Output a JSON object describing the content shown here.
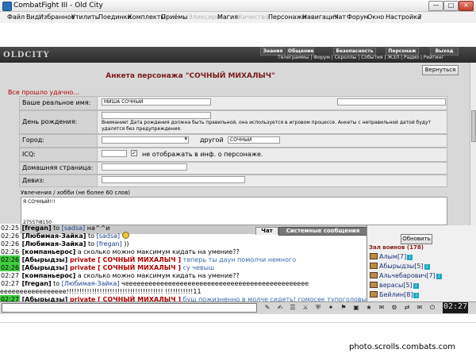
{
  "window": {
    "title": "CombatFight III - Old City"
  },
  "menu": [
    {
      "label": "Файл",
      "disabled": false
    },
    {
      "label": "Вид",
      "disabled": false
    },
    {
      "label": "Избранное",
      "disabled": false
    },
    {
      "label": "Утилиты",
      "disabled": false
    },
    {
      "label": "Поединки",
      "disabled": false
    },
    {
      "label": "Комплекты",
      "disabled": false
    },
    {
      "label": "Приёмы",
      "disabled": false
    },
    {
      "label": "Эликсиры",
      "disabled": true
    },
    {
      "label": "Магия",
      "disabled": false
    },
    {
      "label": "Качество",
      "disabled": true
    },
    {
      "label": "Персонажи",
      "disabled": false
    },
    {
      "label": "Навигация",
      "disabled": false
    },
    {
      "label": "Чат",
      "disabled": false
    },
    {
      "label": "Форум",
      "disabled": false
    },
    {
      "label": "Окно",
      "disabled": false
    },
    {
      "label": "Настройки",
      "disabled": false
    },
    {
      "label": "?",
      "disabled": false
    }
  ],
  "game": {
    "logo": "OLDCITY",
    "tabs": [
      "Знания",
      "Общение",
      "Безопасность",
      "Персонаж",
      "Выход"
    ],
    "subnav": "Телеграммы | Форум | Скроллы | События | ЖЗЛ | Радио | Рейтинг"
  },
  "form": {
    "title": "Анкета персонажа \"СОЧНЫЙ МИХАЛЫЧ\"",
    "back_label": "Вернуться",
    "success_msg": "Все прошло удачно...",
    "real_name_label": "Ваше реальное имя:",
    "real_name_value": "МИША СОЧНЫЙ",
    "birthday_label": "День рождения:",
    "birthday_warning": "Внимание! Дата рождения должна быть правильной, она используется в игровом процессе. Анкеты с неправильной датой будут удалятся без предупреждения.",
    "city_label": "Город:",
    "city_other_label": "другой",
    "city_other_value": "СОЧНЫЙ",
    "icq_label": "ICQ:",
    "icq_hide_label": "не отображать в инф. о персонаже.",
    "homepage_label": "Домашняя страница:",
    "motto_label": "Девиз:",
    "hobby_label": "Увлечения / хобби (не более 60 слов)",
    "hobby_value": "Я СОЧНЫЙ!!!",
    "hobby_extra": "27557I8150"
  },
  "chat": {
    "tab_chat": "Чат",
    "tab_system": "Системные сообщения",
    "lines": [
      {
        "time": "02:25",
        "green": false,
        "user": "fregan",
        "to": "sadsa",
        "msg": " на^^и",
        "priv": false,
        "smile": false
      },
      {
        "time": "02:26",
        "green": false,
        "user": "Любимая-Зайка",
        "to": "sadsa",
        "msg": "",
        "priv": false,
        "smile": true
      },
      {
        "time": "02:26",
        "green": false,
        "user": "Любимая-Зайка",
        "to": "fregan",
        "msg": " ))",
        "priv": false,
        "smile": false
      },
      {
        "time": "02:26",
        "green": false,
        "user": "компаньерос",
        "to": "",
        "msg": " а сколько можно максимум кидать на умение??",
        "priv": false,
        "smile": false
      },
      {
        "time": "02:26",
        "green": true,
        "user": "Абырыдзы",
        "to": "СОЧНЫЙ МИХАЛЫЧ",
        "msg": " теперь ты даун помолчи немного",
        "priv": true,
        "smile": false
      },
      {
        "time": "02:26",
        "green": true,
        "user": "Абырыдзы",
        "to": "СОЧНЫЙ МИХАЛЫЧ",
        "msg": " су чевыш",
        "priv": true,
        "smile": false
      },
      {
        "time": "02:27",
        "green": false,
        "user": "компаньерос",
        "to": "",
        "msg": " а сколько можно максимум кидать на умение??",
        "priv": false,
        "smile": false
      },
      {
        "time": "02:27",
        "green": false,
        "user": "fregan",
        "to": "Любимая-Зайка",
        "msg": " чеееееееееееееееееееееееееееееееееееееееееееееее",
        "priv": false,
        "smile": false
      },
      {
        "time": "",
        "green": false,
        "user": "",
        "to": "",
        "msg": "eeeeeeeeeeeeeeeee!!!!!!!!!!!!!!!!!!!!!!!!!!!!!!!!!!!!!! !!!!!!!!!!!11",
        "priv": false,
        "smile": false
      },
      {
        "time": "02:27",
        "green": true,
        "user": "Абырыдзы",
        "to": "СОЧНЫЙ МИХАЛЫЧ",
        "msg": " буш пожизненно в молче сидеть! гомосек тупоголовый",
        "priv": true,
        "smile": false
      }
    ]
  },
  "room": {
    "refresh_label": "Обновить",
    "title": "Зал воинов (178)",
    "users": [
      {
        "name": "Алым",
        "level": "[7]"
      },
      {
        "name": "Абырыдзы",
        "level": "[5]"
      },
      {
        "name": "Альчебарович",
        "level": "[7]"
      },
      {
        "name": "верасы",
        "level": "[5]"
      },
      {
        "name": "Бейлин",
        "level": "[8]"
      }
    ]
  },
  "toolbar": {
    "clock": "02:27",
    "icons": [
      "scroll-icon",
      "pen-icon",
      "book-icon",
      "sword-icon",
      "shield-icon",
      "fight-icon",
      "map-icon",
      "bag-icon",
      "star-icon",
      "chat-icon",
      "gear-icon",
      "trade-icon",
      "letter-icon",
      "exit-icon"
    ]
  },
  "watermark": "photo.scrolls.combats.com",
  "colors": {
    "accent_red": "#b00000",
    "chat_highlight": "#3fce3f",
    "title_red": "#7a1a1a"
  }
}
